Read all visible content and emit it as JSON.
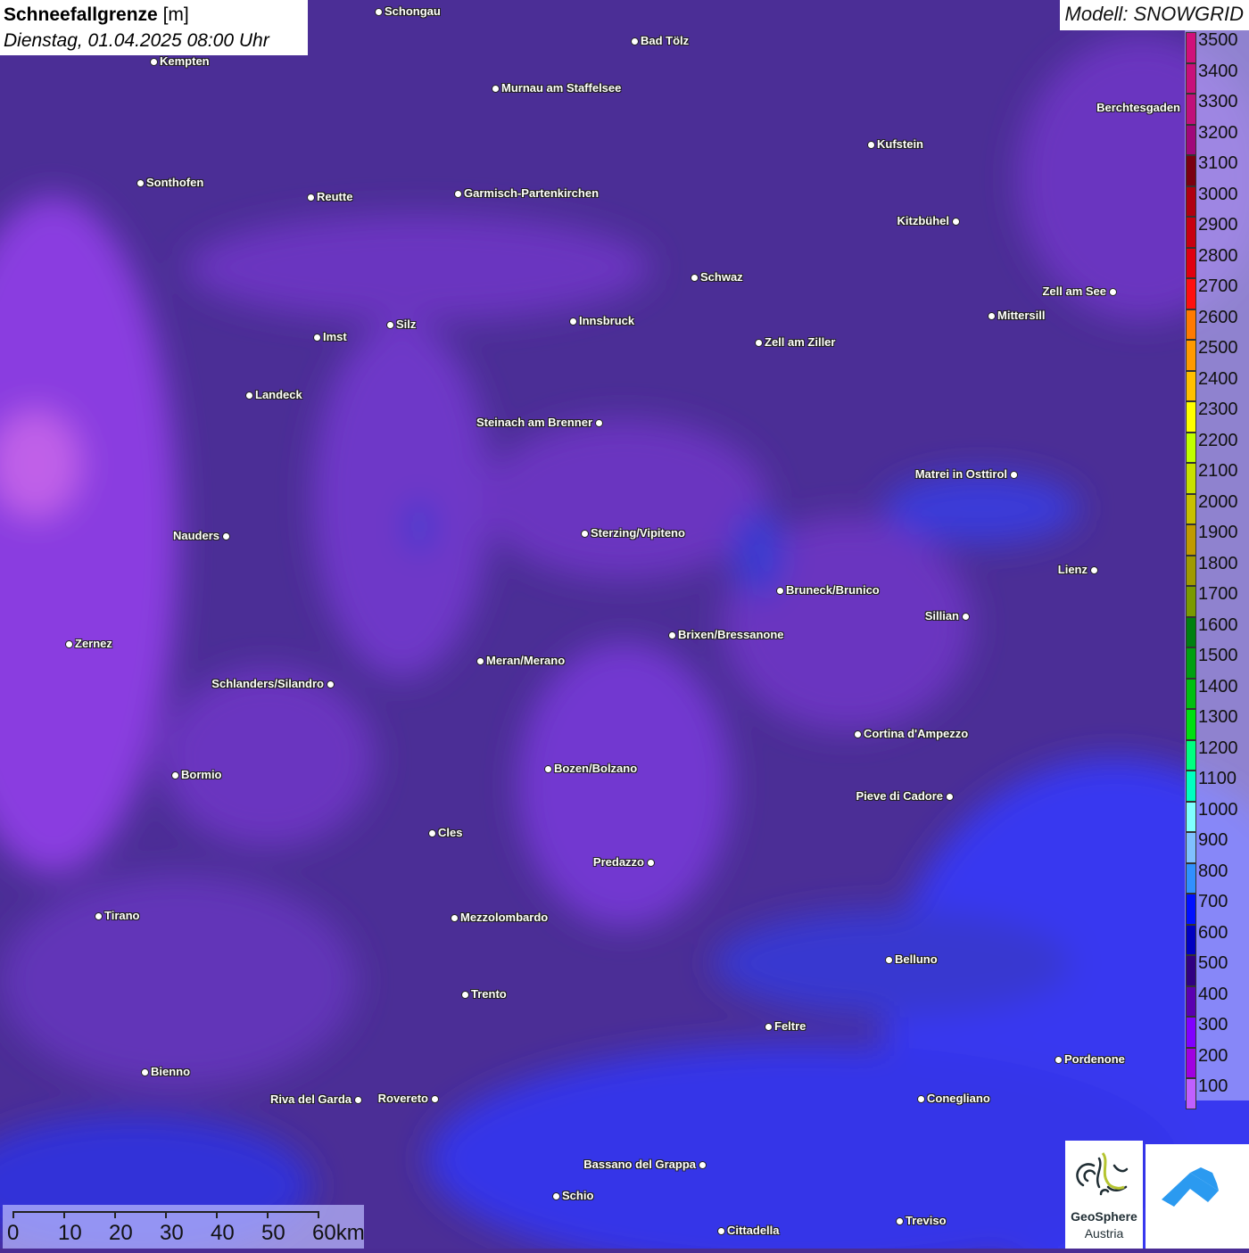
{
  "header": {
    "title": "Schneefallgrenze",
    "unit": "[m]",
    "datetime": "Dienstag, 01.04.2025 08:00 Uhr",
    "model": "Modell: SNOWGRID"
  },
  "cities": [
    "Schongau",
    "Bad Tölz",
    "Kempten",
    "Murnau am Staffelsee",
    "Kufstein",
    "Sonthofen",
    "Reutte",
    "Garmisch-Partenkirchen",
    "Kitzbühel",
    "Schwaz",
    "Zell am See",
    "Mittersill",
    "Innsbruck",
    "Imst",
    "Silz",
    "Zell am Ziller",
    "Landeck",
    "Steinach am Brenner",
    "Matrei in Osttirol",
    "Nauders",
    "Sterzing/Vipiteno",
    "Lienz",
    "Bruneck/Brunico",
    "Sillian",
    "Zernez",
    "Brixen/Bressanone",
    "Meran/Merano",
    "Schlanders/Silandro",
    "Cortina d'Ampezzo",
    "Bozen/Bolzano",
    "Bormio",
    "Pieve di Cadore",
    "Cles",
    "Predazzo",
    "Tirano",
    "Mezzolombardo",
    "Belluno",
    "Trento",
    "Feltre",
    "Pordenone",
    "Bienno",
    "Riva del Garda",
    "Rovereto",
    "Conegliano",
    "Bassano del Grappa",
    "Schio",
    "Cittadella",
    "Treviso",
    "Berchtesgaden"
  ],
  "legend": {
    "levels": [
      "3500",
      "3400",
      "3300",
      "3200",
      "3100",
      "3000",
      "2900",
      "2800",
      "2700",
      "2600",
      "2500",
      "2400",
      "2300",
      "2200",
      "2100",
      "2000",
      "1900",
      "1800",
      "1700",
      "1600",
      "1500",
      "1400",
      "1300",
      "1200",
      "1100",
      "1000",
      "900",
      "800",
      "700",
      "600",
      "500",
      "400",
      "300",
      "200",
      "100"
    ],
    "colors": [
      "#d0107a",
      "#c8107a",
      "#c0107a",
      "#a0087a",
      "#7a0010",
      "#b00010",
      "#c80010",
      "#e00010",
      "#ff1010",
      "#ff7a00",
      "#ff9a00",
      "#ffc000",
      "#ffff00",
      "#c0ff00",
      "#c8e000",
      "#c8c000",
      "#c09a00",
      "#a09a00",
      "#7a9a00",
      "#008010",
      "#00a010",
      "#00c010",
      "#00e010",
      "#00ff80",
      "#00ffc0",
      "#80ffff",
      "#80c0ff",
      "#3090ff",
      "#0010ff",
      "#0000c0",
      "#300080",
      "#5a00b0",
      "#8000ff",
      "#a000e0",
      "#c060ff"
    ]
  },
  "scale": {
    "labels": [
      "0",
      "10",
      "20",
      "30",
      "40",
      "50",
      "60km"
    ]
  },
  "logos": {
    "geosphere_line1": "GeoSphere",
    "geosphere_line2": "Austria"
  }
}
